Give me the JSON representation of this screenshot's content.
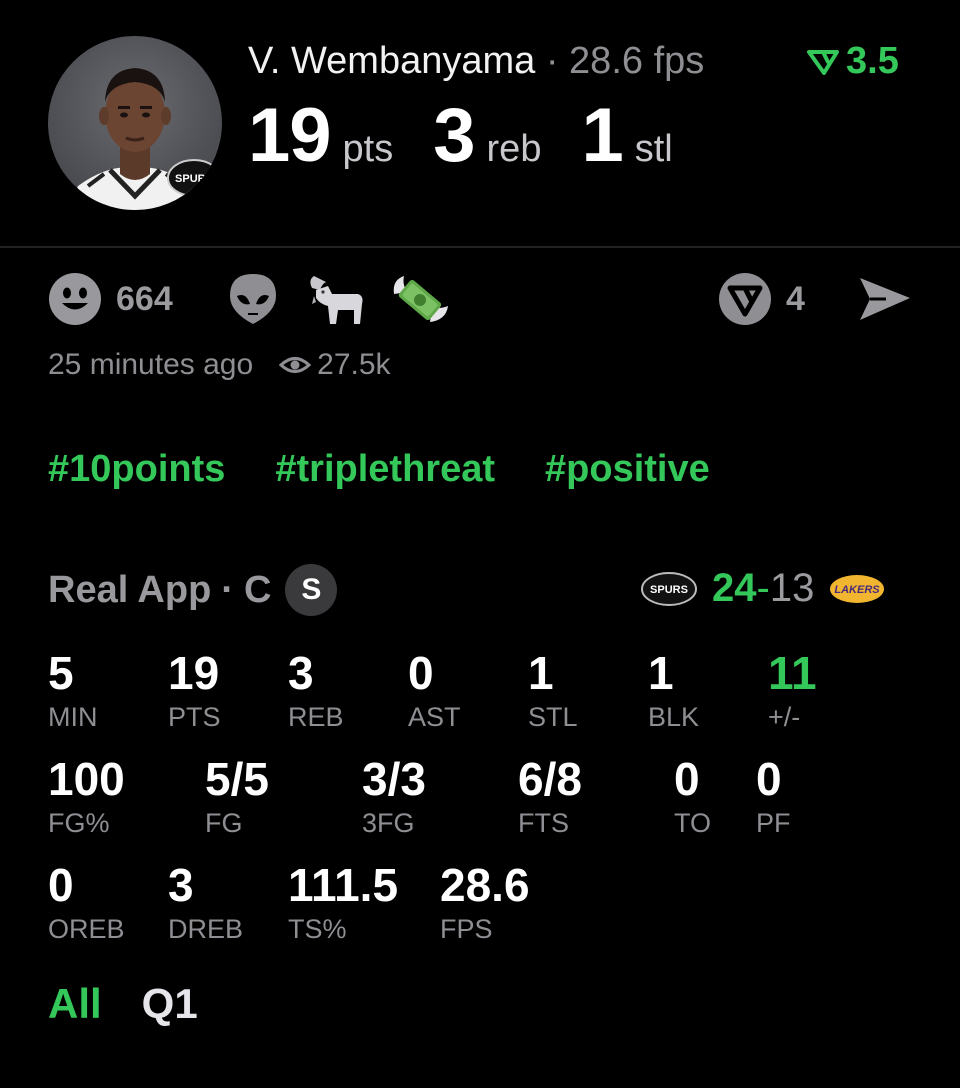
{
  "player": {
    "name": "V. Wembanyama",
    "separator": "·",
    "fps_text": "28.6 fps",
    "rating": "3.5"
  },
  "headline": [
    {
      "value": "19",
      "unit": "pts"
    },
    {
      "value": "3",
      "unit": "reb"
    },
    {
      "value": "1",
      "unit": "stl"
    }
  ],
  "avatar_logo_text": "SPURS",
  "reactions": {
    "smiley_count": "664",
    "icons": [
      "smiley-icon",
      "alien-icon",
      "goat-icon",
      "money-wings-icon"
    ],
    "prediction_count": "4"
  },
  "meta": {
    "time_ago": "25 minutes ago",
    "views": "27.5k"
  },
  "hashtags": [
    "#10points",
    "#triplethreat",
    "#positive"
  ],
  "game": {
    "source": "Real App",
    "separator": "·",
    "position": "C",
    "badge": "S",
    "home_score": "24",
    "dash": "-",
    "away_score": "13",
    "home_logo_text": "SPURS",
    "away_logo_text": "LAKERS"
  },
  "stats": {
    "row1": [
      {
        "value": "5",
        "label": "MIN"
      },
      {
        "value": "19",
        "label": "PTS"
      },
      {
        "value": "3",
        "label": "REB"
      },
      {
        "value": "0",
        "label": "AST"
      },
      {
        "value": "1",
        "label": "STL"
      },
      {
        "value": "1",
        "label": "BLK"
      },
      {
        "value": "11",
        "label": "+/-"
      }
    ],
    "row2": [
      {
        "value": "100",
        "label": "FG%"
      },
      {
        "value": "5/5",
        "label": "FG"
      },
      {
        "value": "3/3",
        "label": "3FG"
      },
      {
        "value": "6/8",
        "label": "FTS"
      },
      {
        "value": "0",
        "label": "TO"
      },
      {
        "value": "0",
        "label": "PF"
      }
    ],
    "row3": [
      {
        "value": "0",
        "label": "OREB"
      },
      {
        "value": "3",
        "label": "DREB"
      },
      {
        "value": "111.5",
        "label": "TS%"
      },
      {
        "value": "28.6",
        "label": "FPS"
      }
    ]
  },
  "filters": {
    "active": "All",
    "tabs": [
      "Q1"
    ]
  },
  "colors": {
    "accent_green": "#34c759",
    "muted": "#8e8e93",
    "background": "#000000"
  }
}
